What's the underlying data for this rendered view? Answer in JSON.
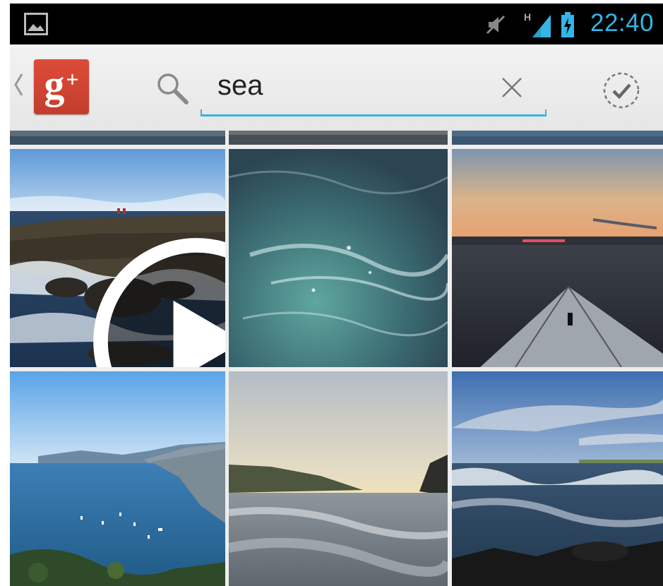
{
  "status_bar": {
    "time": "22:40",
    "network_type": "H",
    "icons": [
      "gallery-thumbnail-icon",
      "muted-icon",
      "signal-icon",
      "battery-charging-icon"
    ],
    "accent_color": "#33b5e5"
  },
  "action_bar": {
    "app_icon": "google-plus-icon",
    "app_icon_glyph": "g",
    "app_icon_plus": "+",
    "search": {
      "value": "sea",
      "placeholder": ""
    },
    "clear_icon": "close-icon",
    "done_icon": "check-circle-icon"
  },
  "photos": [
    {
      "id": "top-1",
      "kind": "photo"
    },
    {
      "id": "top-2",
      "kind": "photo"
    },
    {
      "id": "top-3",
      "kind": "photo"
    },
    {
      "id": "row1-1",
      "kind": "video"
    },
    {
      "id": "row1-2",
      "kind": "photo"
    },
    {
      "id": "row1-3",
      "kind": "photo"
    },
    {
      "id": "row2-1",
      "kind": "photo"
    },
    {
      "id": "row2-2",
      "kind": "photo"
    },
    {
      "id": "row2-3",
      "kind": "photo"
    }
  ]
}
